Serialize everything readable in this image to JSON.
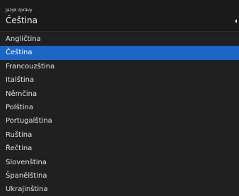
{
  "dropdown": {
    "label": "Jazyk zprávy",
    "value": "Čeština",
    "caret_icon": "caret-left-icon",
    "selected_index": 1,
    "options": [
      "Angličtina",
      "Čeština",
      "Francouzština",
      "Italština",
      "Němčina",
      "Polština",
      "Portugalština",
      "Ruština",
      "Řečtina",
      "Slovenština",
      "Španělština",
      "Ukrajinština"
    ]
  },
  "colors": {
    "background": "#1b1b1b",
    "list_background": "#202020",
    "selected_background": "#1b66c4",
    "text": "#e4e4e4"
  }
}
